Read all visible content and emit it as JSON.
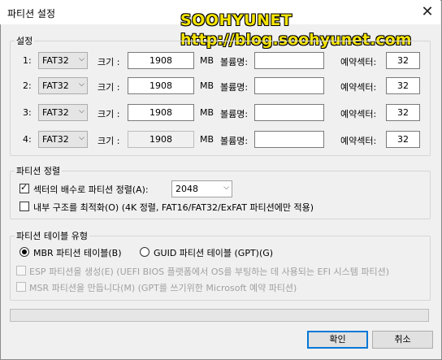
{
  "window": {
    "title": "파티션 설정",
    "close_icon": "✕"
  },
  "watermark": {
    "line1": "SOOHYUNET",
    "line2": "http://blog.soohyunet.com"
  },
  "settings": {
    "group_label": "설정",
    "size_label": "크기 :",
    "unit": "MB",
    "volume_label": "볼륨명:",
    "reserved_label": "예약섹터:",
    "rows": [
      {
        "index": "1:",
        "fs": "FAT32",
        "size": "1908",
        "volume": "",
        "reserved": "32"
      },
      {
        "index": "2:",
        "fs": "FAT32",
        "size": "1908",
        "volume": "",
        "reserved": "32"
      },
      {
        "index": "3:",
        "fs": "FAT32",
        "size": "1908",
        "volume": "",
        "reserved": "32"
      },
      {
        "index": "4:",
        "fs": "FAT32",
        "size": "1908",
        "volume": "",
        "reserved": "32"
      }
    ]
  },
  "alignment": {
    "group_label": "파티션 정렬",
    "align_label": "섹터의 배수로 파티션 정렬(A):",
    "align_checked": true,
    "align_value": "2048",
    "optimize_label": "내부 구조를 최적화(O) (4K 정렬, FAT16/FAT32/ExFAT 파티션에만 적용)",
    "optimize_checked": false
  },
  "table_type": {
    "group_label": "파티션 테이블 유형",
    "mbr_label": "MBR 파티션 테이블(B)",
    "gpt_label": "GUID 파티션 테이블 (GPT)(G)",
    "selected": "mbr",
    "esp_label": "ESP 파티션을 생성(E) (UEFI BIOS 플랫폼에서 OS를 부팅하는 데 사용되는 EFI 시스템 파티션)",
    "msr_label": "MSR 파티션을 만듭니다(M) (GPT를 쓰기위한 Microsoft 예약 파티션)"
  },
  "buttons": {
    "ok": "확인",
    "cancel": "취소"
  }
}
